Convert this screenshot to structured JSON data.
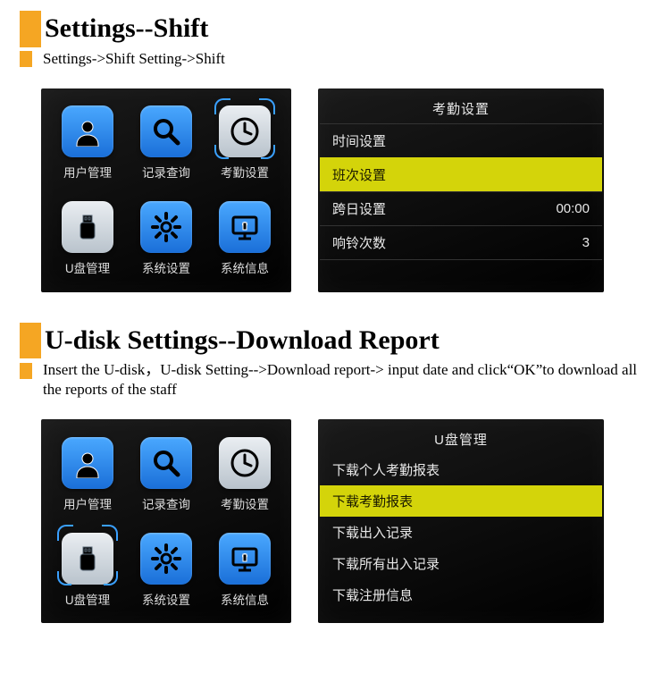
{
  "section1": {
    "title": "Settings--Shift",
    "breadcrumb": "Settings->Shift Setting->Shift",
    "grid": {
      "selected_index": 2,
      "items": [
        {
          "label": "用户管理",
          "icon": "user"
        },
        {
          "label": "记录查询",
          "icon": "search"
        },
        {
          "label": "考勤设置",
          "icon": "clock"
        },
        {
          "label": "U盘管理",
          "icon": "usb"
        },
        {
          "label": "系统设置",
          "icon": "gear"
        },
        {
          "label": "系统信息",
          "icon": "monitor"
        }
      ]
    },
    "list": {
      "title": "考勤设置",
      "selected_index": 1,
      "rows": [
        {
          "label": "时间设置",
          "value": ""
        },
        {
          "label": "班次设置",
          "value": ""
        },
        {
          "label": "跨日设置",
          "value": "00:00"
        },
        {
          "label": "响铃次数",
          "value": "3"
        }
      ]
    }
  },
  "section2": {
    "title": "U-disk Settings--Download Report",
    "description": "Insert the U-disk，U-disk  Setting-->Download report-> input date and click“OK”to download all the reports of the staff",
    "grid": {
      "selected_index": 3,
      "items": [
        {
          "label": "用户管理",
          "icon": "user"
        },
        {
          "label": "记录查询",
          "icon": "search"
        },
        {
          "label": "考勤设置",
          "icon": "clock"
        },
        {
          "label": "U盘管理",
          "icon": "usb"
        },
        {
          "label": "系统设置",
          "icon": "gear"
        },
        {
          "label": "系统信息",
          "icon": "monitor"
        }
      ]
    },
    "list": {
      "title": "U盘管理",
      "selected_index": 1,
      "rows": [
        {
          "label": "下载个人考勤报表",
          "value": ""
        },
        {
          "label": "下载考勤报表",
          "value": ""
        },
        {
          "label": "下载出入记录",
          "value": ""
        },
        {
          "label": "下载所有出入记录",
          "value": ""
        },
        {
          "label": "下载注册信息",
          "value": ""
        }
      ]
    }
  }
}
